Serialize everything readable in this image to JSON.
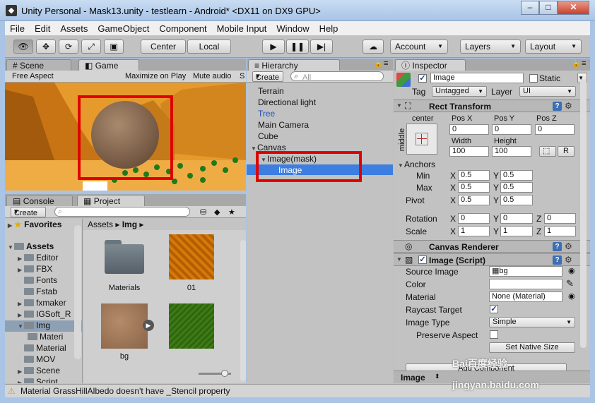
{
  "window": {
    "title": "Unity Personal - Mask13.unity - testlearn - Android* <DX11 on DX9 GPU>",
    "controls": [
      "–",
      "□",
      "✕"
    ]
  },
  "menu": [
    "File",
    "Edit",
    "Assets",
    "GameObject",
    "Component",
    "Mobile Input",
    "Window",
    "Help"
  ],
  "toolbar": {
    "pivot": "Center",
    "space": "Local",
    "account": "Account",
    "layers": "Layers",
    "layout": "Layout",
    "tools": [
      "hand-tool",
      "move-tool",
      "rotate-tool",
      "scale-tool",
      "rect-tool"
    ]
  },
  "scene_panel": {
    "tabs": [
      "Scene",
      "Game"
    ],
    "aspect": "Free Aspect",
    "maximize": "Maximize on Play",
    "mute": "Mute audio",
    "stats": "S"
  },
  "hierarchy": {
    "tab": "Hierarchy",
    "create": "Create",
    "search_placeholder": "All",
    "items": [
      {
        "label": "Terrain"
      },
      {
        "label": "Directional light"
      },
      {
        "label": "Tree"
      },
      {
        "label": "Main Camera"
      },
      {
        "label": "Cube"
      },
      {
        "label": "Canvas"
      },
      {
        "label": "Image(mask)"
      },
      {
        "label": "Image"
      }
    ]
  },
  "project": {
    "tabs": [
      "Console",
      "Project"
    ],
    "create": "Create",
    "favorites": "Favorites",
    "assets_root": "Assets",
    "folders": [
      "Editor",
      "FBX",
      "Fonts",
      "Fstab",
      "fxmaker",
      "IGSoft_R",
      "Img",
      "Materi",
      "Material",
      "MOV",
      "Scene",
      "Script"
    ],
    "breadcrumb": [
      "Assets",
      "Img"
    ],
    "assets": [
      {
        "name": "Materials",
        "kind": "folder"
      },
      {
        "name": "01",
        "kind": "texture-orange"
      },
      {
        "name": "bg",
        "kind": "texture-sand"
      },
      {
        "name": "",
        "kind": "texture-green"
      }
    ]
  },
  "inspector": {
    "tab": "Inspector",
    "object_name": "Image",
    "static_label": "Static",
    "tag_label": "Tag",
    "tag_value": "Untagged",
    "layer_label": "Layer",
    "layer_value": "UI",
    "rect_transform": {
      "title": "Rect Transform",
      "anchor_h": "center",
      "anchor_v": "middle",
      "pos_labels": [
        "Pos X",
        "Pos Y",
        "Pos Z"
      ],
      "pos_values": [
        "0",
        "0",
        "0"
      ],
      "size_labels": [
        "Width",
        "Height"
      ],
      "size_values": [
        "100",
        "100"
      ],
      "raw_button": "R",
      "anchors_label": "Anchors",
      "min_label": "Min",
      "min_x": "0.5",
      "min_y": "0.5",
      "max_label": "Max",
      "max_x": "0.5",
      "max_y": "0.5",
      "pivot_label": "Pivot",
      "pivot_x": "0.5",
      "pivot_y": "0.5",
      "rotation_label": "Rotation",
      "rotation": [
        "0",
        "0",
        "0"
      ],
      "scale_label": "Scale",
      "scale": [
        "1",
        "1",
        "1"
      ],
      "axis_x": "X",
      "axis_y": "Y",
      "axis_z": "Z"
    },
    "canvas_renderer": {
      "title": "Canvas Renderer"
    },
    "image_script": {
      "title": "Image (Script)",
      "source_image_label": "Source Image",
      "source_image_value": "bg",
      "color_label": "Color",
      "material_label": "Material",
      "material_value": "None (Material)",
      "raycast_label": "Raycast Target",
      "image_type_label": "Image Type",
      "image_type_value": "Simple",
      "preserve_label": "Preserve Aspect",
      "native_size": "Set Native Size",
      "add_component": "Add Component"
    },
    "footer_label": "Image"
  },
  "status": {
    "message": "Material GrassHillAlbedo doesn't have _Stencil property"
  },
  "watermark": "Bai百度经验 jingyan.baidu.com"
}
